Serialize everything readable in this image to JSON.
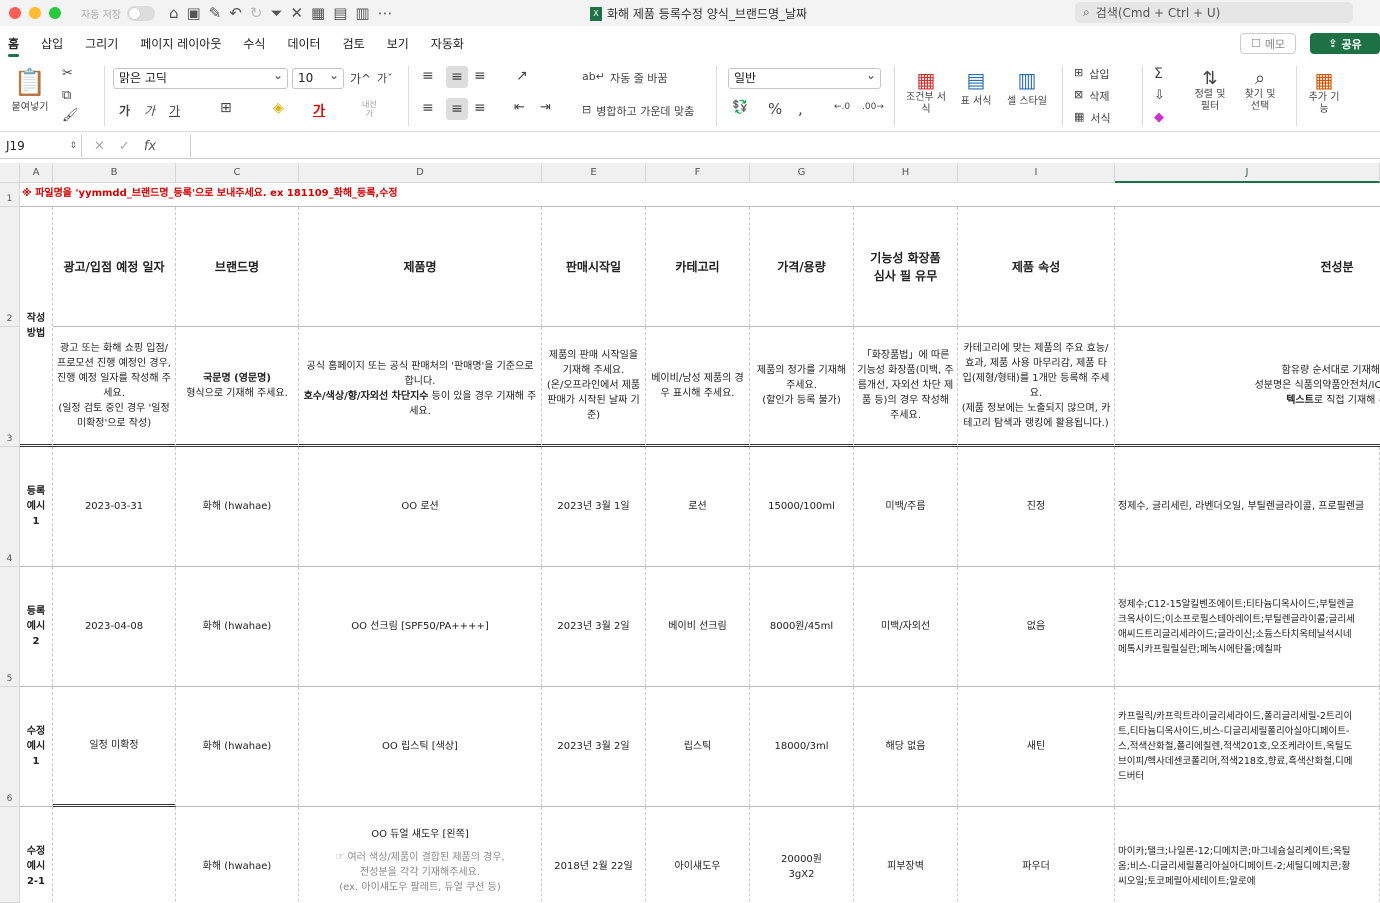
{
  "titlebar": {
    "autosave_label": "자동 저장",
    "doc_title": "화해 제품 등록수정 양식_브랜드명_날짜",
    "search_placeholder": "검색(Cmd + Ctrl + U)"
  },
  "tabs": [
    "홈",
    "삽입",
    "그리기",
    "페이지 레이아웃",
    "수식",
    "데이터",
    "검토",
    "보기",
    "자동화"
  ],
  "memo_label": "메모",
  "share_label": "공유",
  "ribbon": {
    "paste_label": "붙여넣기",
    "font_name": "맑은 고딕",
    "font_size": "10",
    "wrap_label": "자동 줄 바꿈",
    "merge_label": "병합하고 가운데 맞춤",
    "number_format": "일반",
    "cond_format": "조건부 서식",
    "table_format": "표 서식",
    "cell_style": "셀 스타일",
    "insert": "삽입",
    "delete": "삭제",
    "format": "서식",
    "sort_filter": "정렬 및 필터",
    "find_select": "찾기 및 선택",
    "addins": "추가 기능",
    "bold": "가",
    "italic": "가",
    "underline": "가"
  },
  "formula": {
    "cell_ref": "J19",
    "fx": "fx"
  },
  "columns": [
    "A",
    "B",
    "C",
    "D",
    "E",
    "F",
    "G",
    "H",
    "I",
    "J"
  ],
  "rows": [
    "1",
    "2",
    "3",
    "4",
    "5",
    "6"
  ],
  "sheet": {
    "warning": "※ 파일명을 'yymmdd_브랜드명_등록'으로 보내주세요. ex 181109_화해_등록,수정",
    "side_label": "작성\n방법",
    "headers": [
      "광고/입점 예정 일자",
      "브랜드명",
      "제품명",
      "판매시작일",
      "카테고리",
      "가격/용량",
      "기능성 화장품\n심사 필 유무",
      "제품 속성",
      "전성분"
    ],
    "guides": {
      "b": "광고 또는 화해 쇼핑 입점/프로모션 진행 예정인 경우, 진행 예정 일자를 작성해 주세요.\n(일정 검토 중인 경우 '일정 미확정'으로 작성)",
      "c_bold": "국문명 (영문명)",
      "c_rest": "형식으로 기재해 주세요.",
      "d_pre": "공식 홈페이지 또는 공식 판매처의 '판매명'을 기준으로 합니다.",
      "d_bold": "호수/색상/향/자외선 차단지수",
      "d_post": " 등이 있을 경우 기재해 주세요.",
      "e": "제품의 판매 시작일을 기재해 주세요.\n(온/오프라인에서 제품 판매가 시작된 날짜 기준)",
      "f": "베이비/남성 제품의 경우 표시해 주세요.",
      "g": "제품의 정가를 기재해 주세요.\n(할인가 등록 불가)",
      "h": "「화장품법」에 따른 기능성 화장품(미백, 주름개선, 자외선 차단 제품 등)의 경우 작성해 주세요.",
      "i": "카테고리에 맞는 제품의 주요 효능/효과, 제품 사용 마무리감, 제품 타입(제형/형태)를 1개만 등록해 주세요.\n(제품 정보에는 노출되지 않으며, 카테고리 탐색과 랭킹에 활용됩니다.)",
      "j_line1": "함유량 순서대로 기재해 주",
      "j_line2": "성분명은 식품의약품안전처/ICID/EWG",
      "j_bold": "텍스트",
      "j_line3": "로 직접 기재해 주"
    },
    "examples": [
      {
        "label": "등록\n예시\n1",
        "date": "2023-03-31",
        "brand": "화해 (hwahae)",
        "product": "OO 로션",
        "start": "2023년 3월 1일",
        "category": "로션",
        "price": "15000/100ml",
        "functional": "미백/주름",
        "attr": "진정",
        "ingredients": "정제수, 글리세린, 라벤더오일, 부틸렌글라이콜, 프로필렌글"
      },
      {
        "label": "등록\n예시\n2",
        "date": "2023-04-08",
        "brand": "화해 (hwahae)",
        "product": "OO 선크림 [SPF50/PA++++]",
        "start": "2023년 3월 2일",
        "category": "베이비 선크림",
        "price": "8000원/45ml",
        "functional": "미백/자외선",
        "attr": "없음",
        "ingredients": "정제수;C12-15알킬벤조에이트;티타늄디옥사이드;부틸렌글\n크옥사이드;이소프로필스테아레이트;부틸렌글라이콜;글리세\n애씨드트리글리세라이드;글라이신;소듐스타치옥테닐석시네\n메톡시카프릴릴실란;페녹시에탄올;메칠파"
      },
      {
        "label": "수정\n예시\n1",
        "date": "일정 미확정",
        "brand": "화해 (hwahae)",
        "product": "OO 립스틱 [색상]",
        "start": "2023년 3월 2일",
        "category": "립스틱",
        "price": "18000/3ml",
        "functional": "해당 없음",
        "attr": "새틴",
        "ingredients": "카프릴릭/카프릭트라이글리세라이드,폴리글리세릴-2트리이\n트,티타늄디옥사이드,비스-디글리세릴폴리아실아디페이트-\n스,적색산화철,폴리에칠렌,적색201호,오조케라이트,옥틸도\n브이피/헥사데센코폴리머,적색218호,향료,흑색산화철,디메\n드버터"
      },
      {
        "label": "수정\n예시\n2-1",
        "date": "",
        "brand": "화해 (hwahae)",
        "product": "OO 듀얼 섀도우 [왼쪽]",
        "product_note": "☞ 여러 색상/제품이 결합된 제품의 경우,\n전성분을 각각 기재해주세요.\n(ex. 아이섀도우 팔레트, 듀얼 쿠션 등)",
        "start": "2018년 2월 22일",
        "category": "아이섀도우",
        "price": "20000원\n3gX2",
        "functional": "피부장벽",
        "attr": "파우더",
        "ingredients": "마이카;탤크;나일론-12;디메치콘;마그네슘실리케이트;옥틸\n옴;비스-디글리세릴폴리아실아디페이트-2;세틸디메치콘;황\n씨오일;토코페릴아세테이트;알로에"
      }
    ]
  }
}
